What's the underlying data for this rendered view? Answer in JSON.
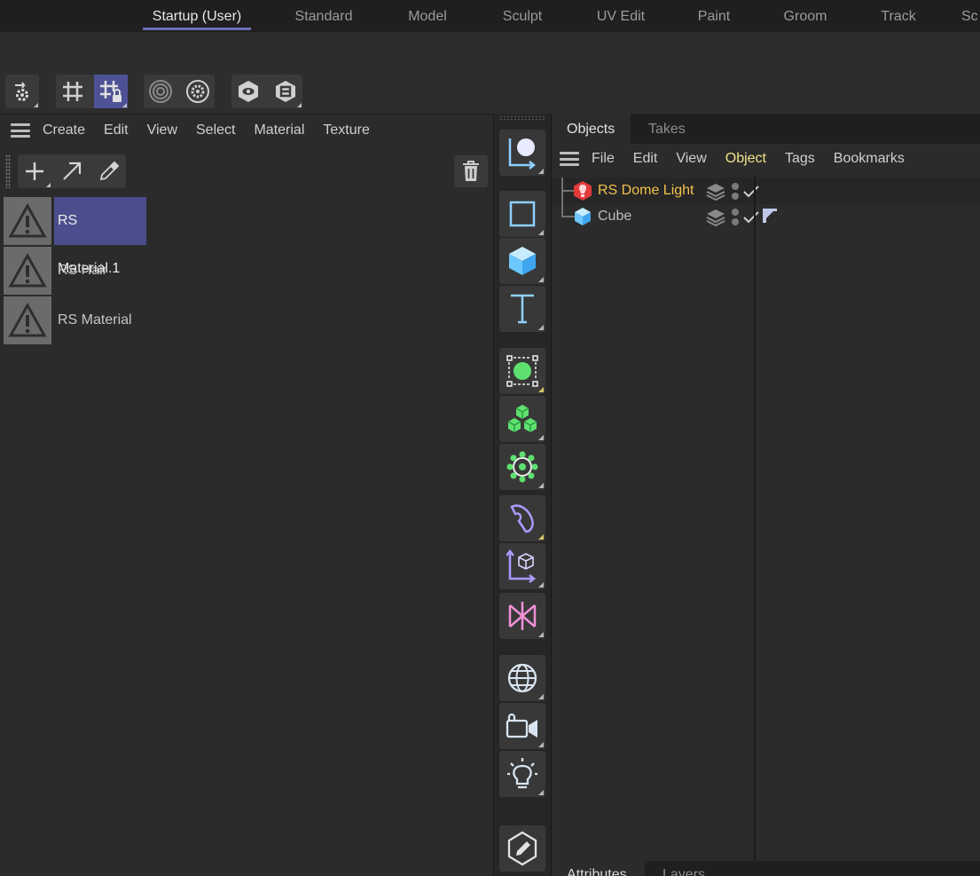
{
  "layouts": {
    "tabs": [
      "Startup (User)",
      "Standard",
      "Model",
      "Sculpt",
      "UV Edit",
      "Paint",
      "Groom",
      "Track",
      "Sc"
    ],
    "active_index": 0,
    "accent_color": "#6a6fb8"
  },
  "toolbar": {
    "icons": [
      "render-settings-gear-icon",
      "grid-icon",
      "grid-lock-icon",
      "radar-icon",
      "snap-settings-gear-icon",
      "eye-badge-icon",
      "layer-badge-icon"
    ],
    "active_icon": "grid-lock-icon"
  },
  "material_manager": {
    "menu": [
      "Create",
      "Edit",
      "View",
      "Select",
      "Material",
      "Texture"
    ],
    "toolbar_icons": [
      "plus-icon",
      "arrow-diagonal-icon",
      "eyedropper-icon",
      "trash-icon"
    ],
    "materials": [
      {
        "name": "RS Material.1",
        "selected": true,
        "icon": "warning-triangle-icon"
      },
      {
        "name": "RS Hair",
        "selected": false,
        "icon": "warning-triangle-icon"
      },
      {
        "name": "RS Material",
        "selected": false,
        "icon": "warning-triangle-icon"
      }
    ],
    "selection_color": "#4a4e8c"
  },
  "palette": {
    "icons": [
      "coordinate-system-icon",
      "square-icon",
      "cube-icon",
      "text-icon",
      "mograph-cloner-icon",
      "cubes-stack-icon",
      "gear-nodes-icon",
      "deformer-bend-icon",
      "object-axis-icon",
      "effector-icon",
      "globe-icon",
      "camera-icon",
      "light-bulb-icon",
      "edit-pencil-icon"
    ]
  },
  "object_manager": {
    "tabs": [
      "Objects",
      "Takes"
    ],
    "active_tab": "Objects",
    "menu": [
      "File",
      "Edit",
      "View",
      "Object",
      "Tags",
      "Bookmarks"
    ],
    "highlight_menu": "Object",
    "objects": [
      {
        "name": "RS Dome Light",
        "icon": "dome-light-icon",
        "color": "#f2c24c"
      },
      {
        "name": "Cube",
        "icon": "cube-icon",
        "color": "#bdbdbd"
      }
    ]
  },
  "attributes": {
    "tabs": [
      "Attributes",
      "Layers"
    ]
  }
}
